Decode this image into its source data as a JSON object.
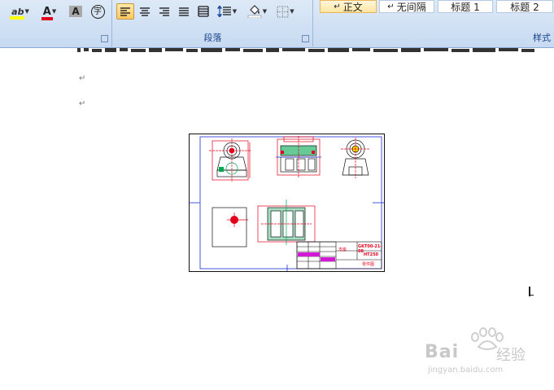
{
  "ribbon": {
    "font_group": {
      "highlight_label": "ab",
      "font_color_label": "A",
      "char_shading_label": "A",
      "enclose_char_label": "字"
    },
    "paragraph_group": {
      "label": "段落"
    },
    "styles_group": {
      "label": "样式",
      "items": [
        {
          "mark": "↵",
          "label": "正文"
        },
        {
          "mark": "↵",
          "label": "无间隔"
        },
        {
          "mark": "",
          "label": "标题 1"
        },
        {
          "mark": "",
          "label": "标题 2"
        }
      ]
    }
  },
  "document": {
    "para_mark": "↵"
  },
  "drawing": {
    "title_part_no": "GKT00-21-08",
    "material": "HT250",
    "subtitle": "支座",
    "note": "零件图"
  },
  "watermark": {
    "brand": "Bai",
    "brand2": "经验",
    "url": "jingyan.baidu.com"
  },
  "colors": {
    "ribbon_top": "#dde9f7",
    "ribbon_bottom": "#c7daf1",
    "label_text": "#15428b",
    "cad_red": "#e3001b",
    "cad_green": "#00a651",
    "cad_blue": "#1f2fd6",
    "cad_magenta": "#d21ad6"
  }
}
